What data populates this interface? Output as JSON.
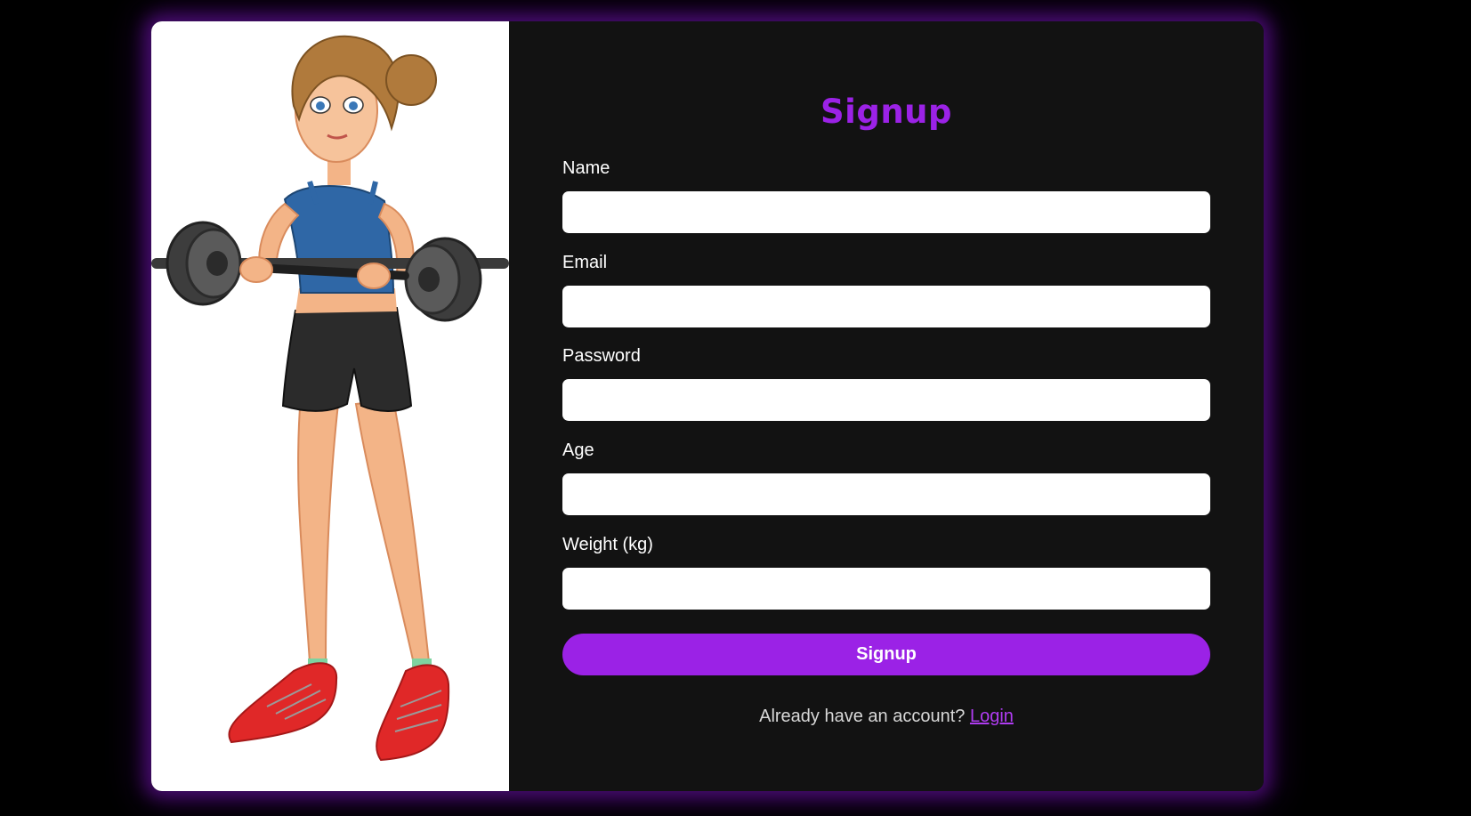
{
  "form": {
    "title": "Signup",
    "fields": [
      {
        "label": "Name",
        "value": "",
        "placeholder": ""
      },
      {
        "label": "Email",
        "value": "",
        "placeholder": ""
      },
      {
        "label": "Password",
        "value": "",
        "placeholder": ""
      },
      {
        "label": "Age",
        "value": "",
        "placeholder": ""
      },
      {
        "label": "Weight (kg)",
        "value": "",
        "placeholder": ""
      }
    ],
    "submit_label": "Signup",
    "login_prompt": "Already have an account?",
    "login_link": "Login"
  },
  "illustration": {
    "icon": "woman-lifting-barbell-illustration"
  },
  "colors": {
    "accent": "#9b22e6",
    "link": "#b03cf2",
    "panel_background": "#121212",
    "page_background": "#000000"
  }
}
